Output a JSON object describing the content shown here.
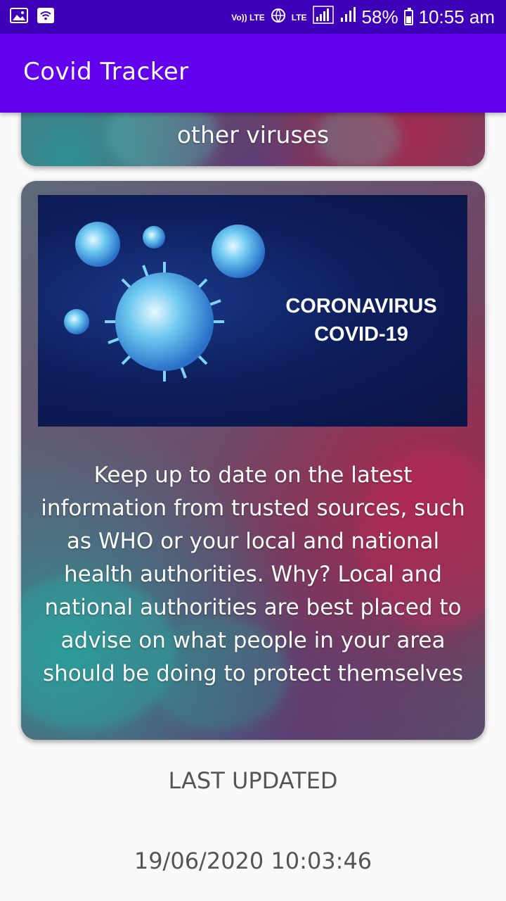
{
  "status_bar": {
    "volte": "Vo)) LTE",
    "lte": "LTE",
    "battery": "58%",
    "time": "10:55 am",
    "icons": [
      "image-icon",
      "wifi-icon",
      "volte-icon",
      "data-saver-icon",
      "signal-icon",
      "signal-icon-2",
      "battery-icon"
    ]
  },
  "app_bar": {
    "title": "Covid Tracker",
    "color": "#6200ee"
  },
  "cards": {
    "top_text": "other viruses",
    "main": {
      "image_caption_line1": "CORONAVIRUS",
      "image_caption_line2": "COVID-19",
      "body": "Keep up to date on the latest information from trusted sources, such as WHO or your local and national health authorities. Why? Local and national authorities are best placed to advise on what people in your area should be doing to protect themselves"
    }
  },
  "footer": {
    "last_updated_label": "LAST UPDATED",
    "last_updated_value": "19/06/2020 10:03:46"
  }
}
